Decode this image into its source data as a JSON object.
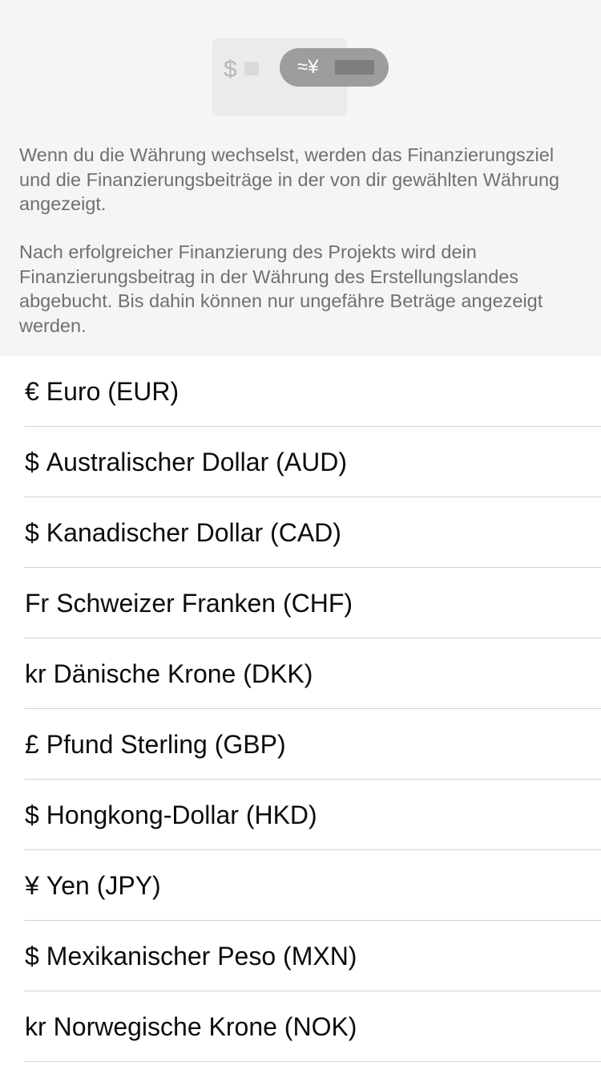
{
  "illustration": {
    "left_symbol": "$",
    "pill_symbol": "≈¥"
  },
  "info": {
    "paragraph_1": "Wenn du die Währung wechselst, werden das Finanzierungsziel und die Finanzierungsbeiträge in der von dir gewählten Währung angezeigt.",
    "paragraph_2": "Nach erfolgreicher Finanzierung des Projekts wird dein Finanzierungsbeitrag in der Währung des Erstellungslandes abgebucht. Bis dahin können nur ungefähre Beträge angezeigt werden."
  },
  "currencies": [
    {
      "symbol": "€",
      "name": "Euro (EUR)"
    },
    {
      "symbol": "$",
      "name": "Australischer Dollar (AUD)"
    },
    {
      "symbol": "$",
      "name": "Kanadischer Dollar (CAD)"
    },
    {
      "symbol": "Fr",
      "name": "Schweizer Franken (CHF)"
    },
    {
      "symbol": "kr",
      "name": "Dänische Krone (DKK)"
    },
    {
      "symbol": "£",
      "name": "Pfund Sterling (GBP)"
    },
    {
      "symbol": "$",
      "name": "Hongkong-Dollar (HKD)"
    },
    {
      "symbol": "¥",
      "name": "Yen (JPY)"
    },
    {
      "symbol": "$",
      "name": "Mexikanischer Peso (MXN)"
    },
    {
      "symbol": "kr",
      "name": "Norwegische Krone (NOK)"
    }
  ]
}
